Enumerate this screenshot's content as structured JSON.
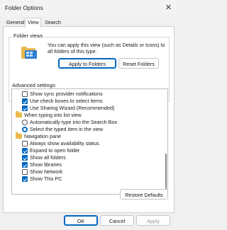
{
  "window": {
    "title": "Folder Options",
    "close_glyph": "✕"
  },
  "tabs": [
    {
      "label": "General",
      "active": false
    },
    {
      "label": "View",
      "active": true
    },
    {
      "label": "Search",
      "active": false
    }
  ],
  "folder_views": {
    "label": "Folder views",
    "description": "You can apply this view (such as Details or Icons) to all folders of this type.",
    "apply_button": "Apply to Folders",
    "reset_button": "Reset Folders",
    "icon": "folder-view-icon"
  },
  "advanced": {
    "label": "Advanced settings:",
    "items": [
      {
        "type": "checkbox",
        "checked": false,
        "label": "Show sync provider notifications"
      },
      {
        "type": "checkbox",
        "checked": true,
        "label": "Use check boxes to select items"
      },
      {
        "type": "checkbox",
        "checked": true,
        "label": "Use Sharing Wizard (Recommended)"
      },
      {
        "type": "folder",
        "label": "When typing into list view"
      },
      {
        "type": "radio",
        "checked": false,
        "label": "Automatically type into the Search Box"
      },
      {
        "type": "radio",
        "checked": true,
        "label": "Select the typed item in the view"
      },
      {
        "type": "folder",
        "label": "Navigation pane"
      },
      {
        "type": "checkbox",
        "checked": false,
        "label": "Always show availability status"
      },
      {
        "type": "checkbox",
        "checked": true,
        "label": "Expand to open folder"
      },
      {
        "type": "checkbox",
        "checked": true,
        "label": "Show all folders"
      },
      {
        "type": "checkbox",
        "checked": true,
        "label": "Show libraries"
      },
      {
        "type": "checkbox",
        "checked": false,
        "label": "Show Network"
      },
      {
        "type": "checkbox",
        "checked": true,
        "label": "Show This PC"
      }
    ]
  },
  "buttons": {
    "restore": "Restore Defaults",
    "ok": "OK",
    "cancel": "Cancel",
    "apply": "Apply"
  },
  "colors": {
    "accent": "#0067c0",
    "folder": "#e8b94a"
  }
}
